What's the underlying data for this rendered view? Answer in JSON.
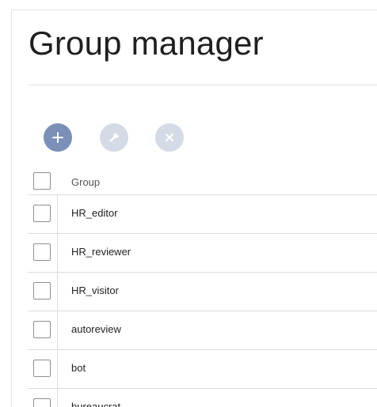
{
  "page": {
    "title": "Group manager"
  },
  "toolbar": {
    "add_icon": "plus-icon",
    "edit_icon": "wrench-icon",
    "delete_icon": "close-icon",
    "accent_color": "#7a90b9",
    "disabled_color": "#d5dbe6"
  },
  "table": {
    "columns": [
      "Group"
    ],
    "rows": [
      {
        "name": "HR_editor"
      },
      {
        "name": "HR_reviewer"
      },
      {
        "name": "HR_visitor"
      },
      {
        "name": "autoreview"
      },
      {
        "name": "bot"
      },
      {
        "name": "bureaucrat"
      }
    ]
  }
}
